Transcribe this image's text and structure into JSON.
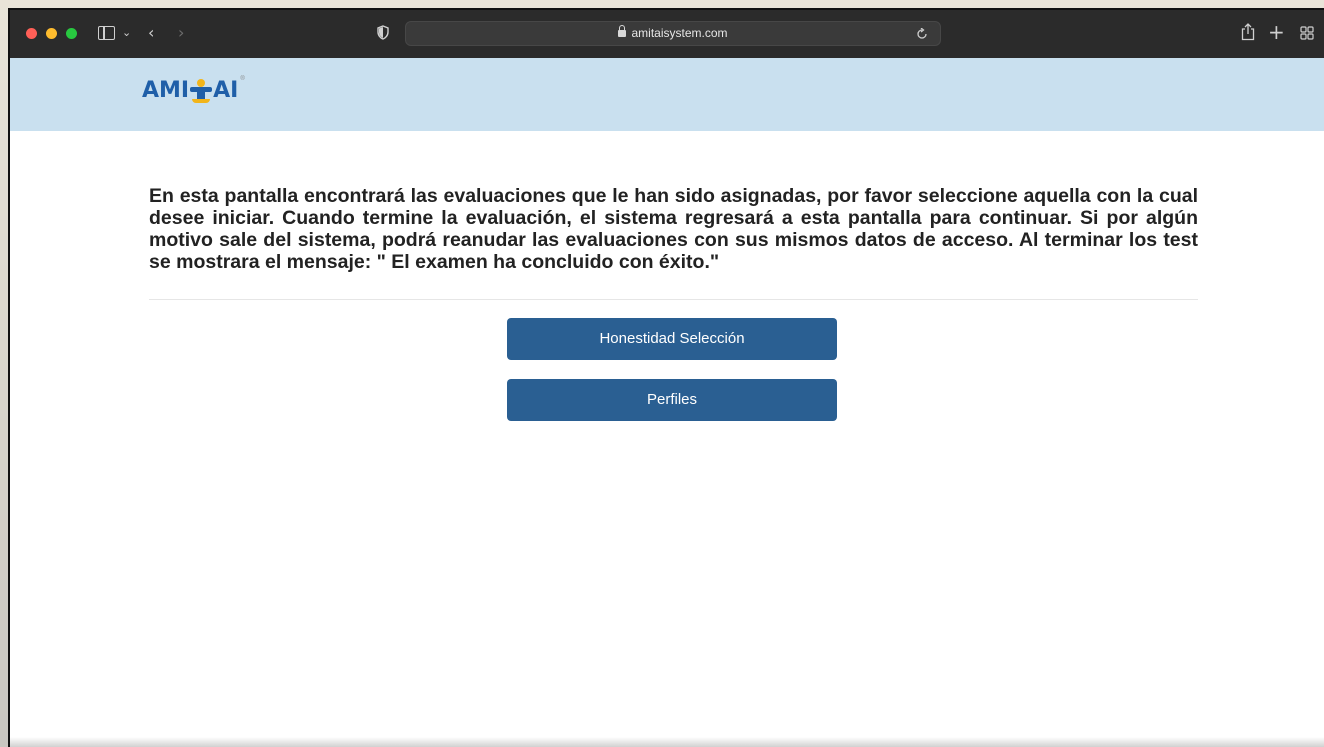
{
  "browser": {
    "url": "amitaisystem.com",
    "icons": {
      "sidebar": "sidebar-icon",
      "chevron": "chevron-down-icon",
      "back": "back-icon",
      "forward": "forward-icon",
      "privacy": "shield-icon",
      "lock": "lock-icon",
      "reload": "reload-icon",
      "share": "share-icon",
      "new_tab": "plus-icon",
      "tab_overview": "tab-overview-icon"
    }
  },
  "header": {
    "logo_left": "AMI",
    "logo_right": "AI",
    "logo_mark": "®"
  },
  "main": {
    "instructions": "En esta pantalla encontrará las evaluaciones que le han sido asignadas, por favor seleccione aquella con la cual desee iniciar. Cuando termine la evaluación, el sistema regresará a esta pantalla para continuar. Si por algún motivo sale del sistema, podrá reanudar las evaluaciones con sus mismos datos de acceso. Al terminar los test se mostrara el mensaje: \" El examen ha concluido con éxito.\"",
    "evaluations": [
      {
        "label": "Honestidad Selección"
      },
      {
        "label": "Perfiles"
      }
    ]
  },
  "colors": {
    "toolbar": "#2b2b2b",
    "header_bg": "#c9e0ef",
    "button_bg": "#2a5f92",
    "logo_blue": "#1f5fa8",
    "logo_yellow": "#f2b51a"
  }
}
